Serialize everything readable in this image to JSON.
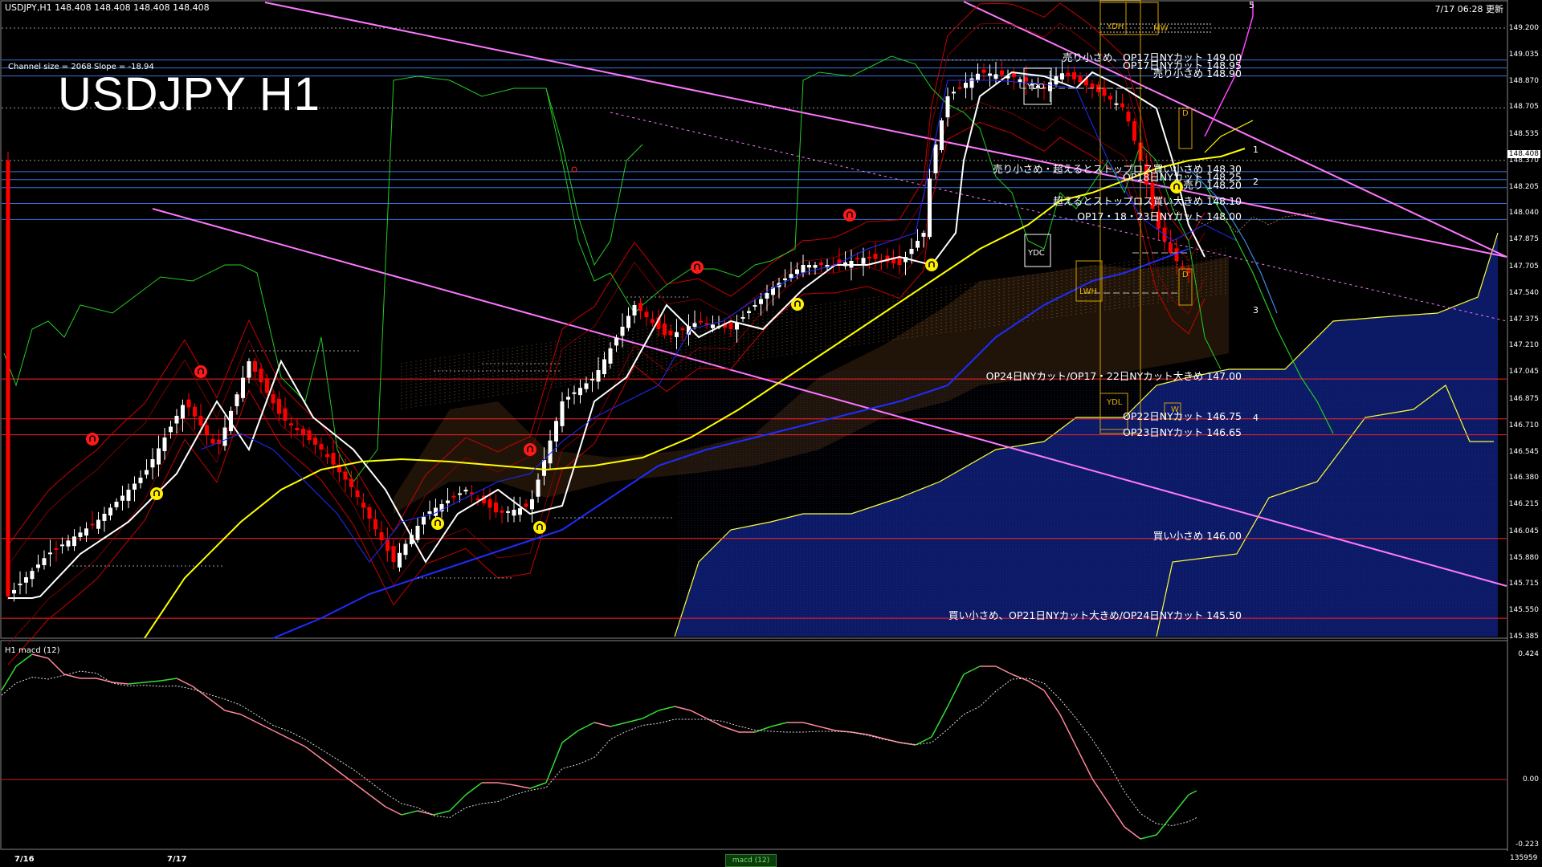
{
  "window": {
    "symbol_info": "USDJPY,H1  148.408 148.408 148.408 148.408",
    "datetime_label": "7/17 06:28 更新",
    "channel_info": "Channel size = 2068 Slope = -18.94",
    "chart_title": "USDJPY H1"
  },
  "price_axis": {
    "ticks": [
      "149.200",
      "149.035",
      "148.870",
      "148.705",
      "148.535",
      "148.370",
      "148.205",
      "148.040",
      "147.875",
      "147.705",
      "147.540",
      "147.375",
      "147.210",
      "147.045",
      "146.875",
      "146.710",
      "146.545",
      "146.380",
      "146.215",
      "146.045",
      "145.880",
      "145.715",
      "145.550",
      "145.385"
    ],
    "current_price": "148.408"
  },
  "annotations": [
    {
      "text": "売り小さめ、OP17日NYカット 149.00",
      "price": 149.0
    },
    {
      "text": "OP17日NYカット 148.95",
      "price": 148.95
    },
    {
      "text": "売り小さめ 148.90",
      "price": 148.9
    },
    {
      "text": "売り小さめ・超えるとストップロス買い小さめ 148.30",
      "price": 148.3
    },
    {
      "text": "OP18日NYカット 148.25",
      "price": 148.25
    },
    {
      "text": "売り 148.20",
      "price": 148.2
    },
    {
      "text": "超えるとストップロス買い大きめ 148.10",
      "price": 148.1
    },
    {
      "text": "OP17・18・23日NYカット 148.00",
      "price": 148.0
    },
    {
      "text": "OP24日NYカット/OP17・22日NYカット大きめ 147.00",
      "price": 147.0
    },
    {
      "text": "OP22日NYカット 146.75",
      "price": 146.75
    },
    {
      "text": "OP23日NYカット 146.65",
      "price": 146.65
    },
    {
      "text": "買い小さめ 146.00",
      "price": 146.0
    },
    {
      "text": "買い小さめ、OP21日NYカット大きめ/OP24日NYカット 145.50",
      "price": 145.5
    }
  ],
  "box_labels": [
    "YDH",
    "YDO",
    "YDC",
    "YDL",
    "LWH",
    "W",
    "MW",
    "D"
  ],
  "line_numbers": [
    "1",
    "2",
    "3",
    "4",
    "5"
  ],
  "indicator": {
    "label": "H1  macd (12)",
    "ticks": [
      "0.424",
      "0.00",
      "-0.223"
    ]
  },
  "bottom": {
    "days": [
      "7/16",
      "7/17"
    ],
    "volume": "135959",
    "macd_tab": "macd (12)"
  },
  "colors": {
    "background": "#000000",
    "bull_candle": "#ffffff",
    "bear_candle": "#ff0000",
    "ma_fast": "#ffffff",
    "ma_mid": "#ffff00",
    "ma_slow": "#1f2cff",
    "chikou": "#22cc22",
    "bollinger": "#cc0000",
    "trendline": "#ff77ff",
    "hline_blue": "#3a6fd8",
    "hline_red": "#ff2222",
    "macd_up": "#33dd33",
    "macd_down": "#ff8899"
  }
}
